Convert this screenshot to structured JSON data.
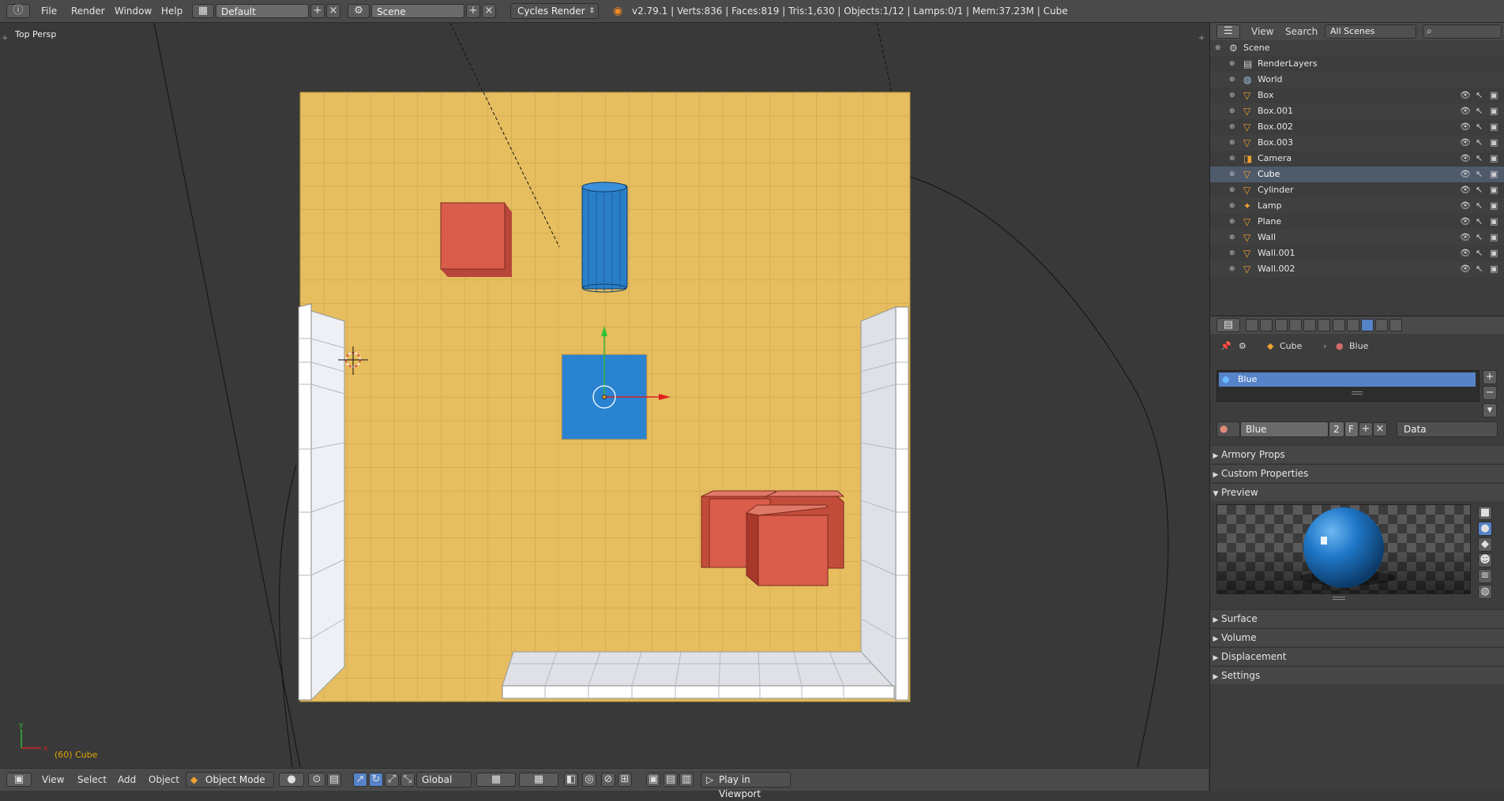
{
  "topbar": {
    "menus": [
      "File",
      "Render",
      "Window",
      "Help"
    ],
    "screen_layout": "Default",
    "scene": "Scene",
    "render_engine": "Cycles Render",
    "stats": "v2.79.1 | Verts:836 | Faces:819 | Tris:1,630 | Objects:1/12 | Lamps:0/1 | Mem:37.23M | Cube"
  },
  "viewport": {
    "view_label": "Top Persp",
    "active_object_label": "(60) Cube",
    "axis_x": "x",
    "axis_y": "y"
  },
  "bottombar": {
    "menus": [
      "View",
      "Select",
      "Add",
      "Object"
    ],
    "mode": "Object Mode",
    "orientation": "Global",
    "play_button": "Play in Viewport"
  },
  "outliner": {
    "menus": [
      "View",
      "Search"
    ],
    "filter": "All Scenes",
    "rows": [
      {
        "name": "Scene",
        "indent": 0,
        "icon": "scene-icon",
        "visibility": false
      },
      {
        "name": "RenderLayers",
        "indent": 1,
        "icon": "renderlayers-icon",
        "visibility": false
      },
      {
        "name": "World",
        "indent": 1,
        "icon": "world-icon",
        "visibility": false
      },
      {
        "name": "Box",
        "indent": 1,
        "icon": "mesh-object-icon",
        "visibility": true
      },
      {
        "name": "Box.001",
        "indent": 1,
        "icon": "mesh-object-icon",
        "visibility": true
      },
      {
        "name": "Box.002",
        "indent": 1,
        "icon": "mesh-object-icon",
        "visibility": true
      },
      {
        "name": "Box.003",
        "indent": 1,
        "icon": "mesh-object-icon",
        "visibility": true
      },
      {
        "name": "Camera",
        "indent": 1,
        "icon": "camera-object-icon",
        "visibility": true
      },
      {
        "name": "Cube",
        "indent": 1,
        "icon": "mesh-object-icon",
        "visibility": true,
        "active": true
      },
      {
        "name": "Cylinder",
        "indent": 1,
        "icon": "mesh-object-icon",
        "visibility": true
      },
      {
        "name": "Lamp",
        "indent": 1,
        "icon": "lamp-object-icon",
        "visibility": true
      },
      {
        "name": "Plane",
        "indent": 1,
        "icon": "mesh-object-icon",
        "visibility": true
      },
      {
        "name": "Wall",
        "indent": 1,
        "icon": "mesh-object-icon",
        "visibility": true
      },
      {
        "name": "Wall.001",
        "indent": 1,
        "icon": "mesh-object-icon",
        "visibility": true
      },
      {
        "name": "Wall.002",
        "indent": 1,
        "icon": "mesh-object-icon",
        "visibility": true
      }
    ]
  },
  "properties": {
    "breadcrumb_object": "Cube",
    "breadcrumb_material": "Blue",
    "material_slot": "Blue",
    "material_name": "Blue",
    "user_count": "2",
    "fake_user": "F",
    "link_type": "Data",
    "panels_top": [
      "Armory Props",
      "Custom Properties"
    ],
    "preview_label": "Preview",
    "panels_bottom": [
      "Surface",
      "Volume",
      "Displacement",
      "Settings"
    ]
  },
  "colors": {
    "floor": "#e6bd5f",
    "box": "#d95d4a",
    "cube": "#2a83d0",
    "wall": "#f1f2f6",
    "selection_highlight": "#5683c8"
  }
}
